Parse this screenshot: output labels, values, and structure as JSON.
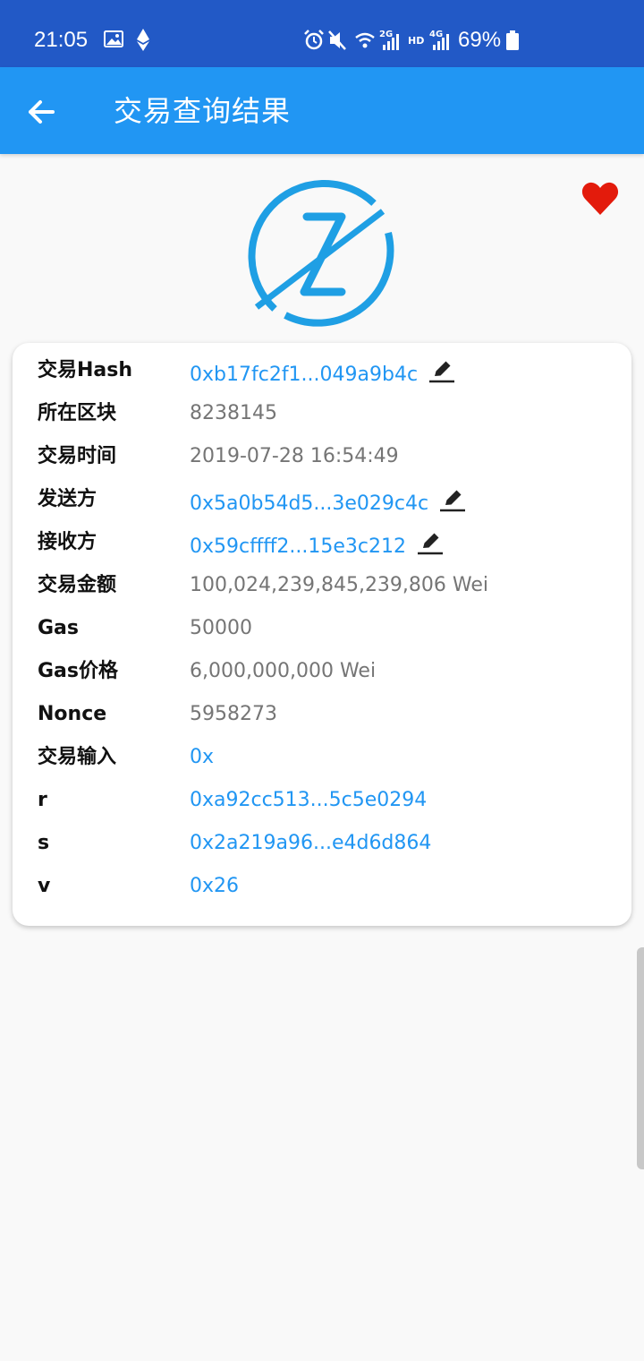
{
  "status_bar": {
    "time": "21:05",
    "battery": "69%",
    "icons": [
      "image-icon",
      "ethereum-icon",
      "alarm-icon",
      "mute-icon",
      "wifi-icon",
      "signal-2g-icon",
      "hd-icon",
      "signal-4g-icon",
      "battery-icon"
    ]
  },
  "app_bar": {
    "title": "交易查询结果",
    "back_icon": "arrow-left-icon"
  },
  "favorite_icon": "heart-icon",
  "logo_icon": "z-logo-icon",
  "colors": {
    "status_bar": "#2259c6",
    "app_bar": "#2196f3",
    "link": "#2196f3",
    "heart": "#e31b0c"
  },
  "details": [
    {
      "label": "交易Hash",
      "value": "0xb17fc2f1...049a9b4c",
      "link": true,
      "editable": true
    },
    {
      "label": "所在区块",
      "value": "8238145",
      "link": false,
      "editable": false
    },
    {
      "label": "交易时间",
      "value": "2019-07-28 16:54:49",
      "link": false,
      "editable": false
    },
    {
      "label": "发送方",
      "value": "0x5a0b54d5...3e029c4c",
      "link": true,
      "editable": true
    },
    {
      "label": "接收方",
      "value": "0x59cffff2...15e3c212",
      "link": true,
      "editable": true
    },
    {
      "label": "交易金额",
      "value": "100,024,239,845,239,806 Wei",
      "link": false,
      "editable": false
    },
    {
      "label": "Gas",
      "value": "50000",
      "link": false,
      "editable": false
    },
    {
      "label": "Gas价格",
      "value": "6,000,000,000 Wei",
      "link": false,
      "editable": false
    },
    {
      "label": "Nonce",
      "value": "5958273",
      "link": false,
      "editable": false
    },
    {
      "label": "交易输入",
      "value": "0x",
      "link": true,
      "editable": false
    },
    {
      "label": "r",
      "value": "0xa92cc513...5c5e0294",
      "link": true,
      "editable": false
    },
    {
      "label": "s",
      "value": "0x2a219a96...e4d6d864",
      "link": true,
      "editable": false
    },
    {
      "label": "v",
      "value": "0x26",
      "link": true,
      "editable": false
    }
  ]
}
